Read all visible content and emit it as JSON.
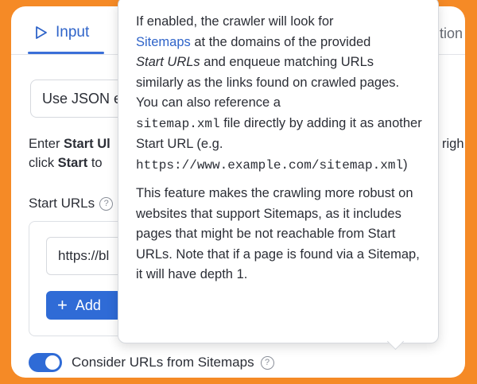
{
  "tabs": {
    "input_label": "Input",
    "partial_label": "ıtion"
  },
  "json_button": {
    "label": "Use JSON e"
  },
  "instructions": {
    "line1_prefix": "Enter ",
    "line1_bold": "Start Ul",
    "line2_prefix": "click ",
    "line2_bold": "Start",
    "line2_suffix": " to",
    "right_fragment": "righ"
  },
  "start_urls": {
    "label": "Start URLs",
    "input_value": "https://bl",
    "add_label": "Add"
  },
  "sitemaps_toggle": {
    "label": "Consider URLs from Sitemaps",
    "enabled": true
  },
  "tooltip": {
    "p1_a": "If enabled, the crawler will look for",
    "p1_link": "Sitemaps",
    "p1_b": " at the domains of the provided",
    "p1_em": "Start URLs",
    "p1_c": " and enqueue matching URLs similarly as the links found on crawled pages. You can also reference a",
    "p1_code1": "sitemap.xml",
    "p1_d": " file directly by adding it as another Start URL (e.g.",
    "p1_code2": "https://www.example.com/sitemap.xml",
    "p1_e": ")",
    "p2": "This feature makes the crawling more robust on websites that support Sitemaps, as it includes pages that might be not reachable from Start URLs. Note that if a page is found via a Sitemap, it will have depth 1."
  },
  "colors": {
    "accent": "#2F6BD6",
    "frame": "#F58A26",
    "link": "#2F64C9"
  }
}
